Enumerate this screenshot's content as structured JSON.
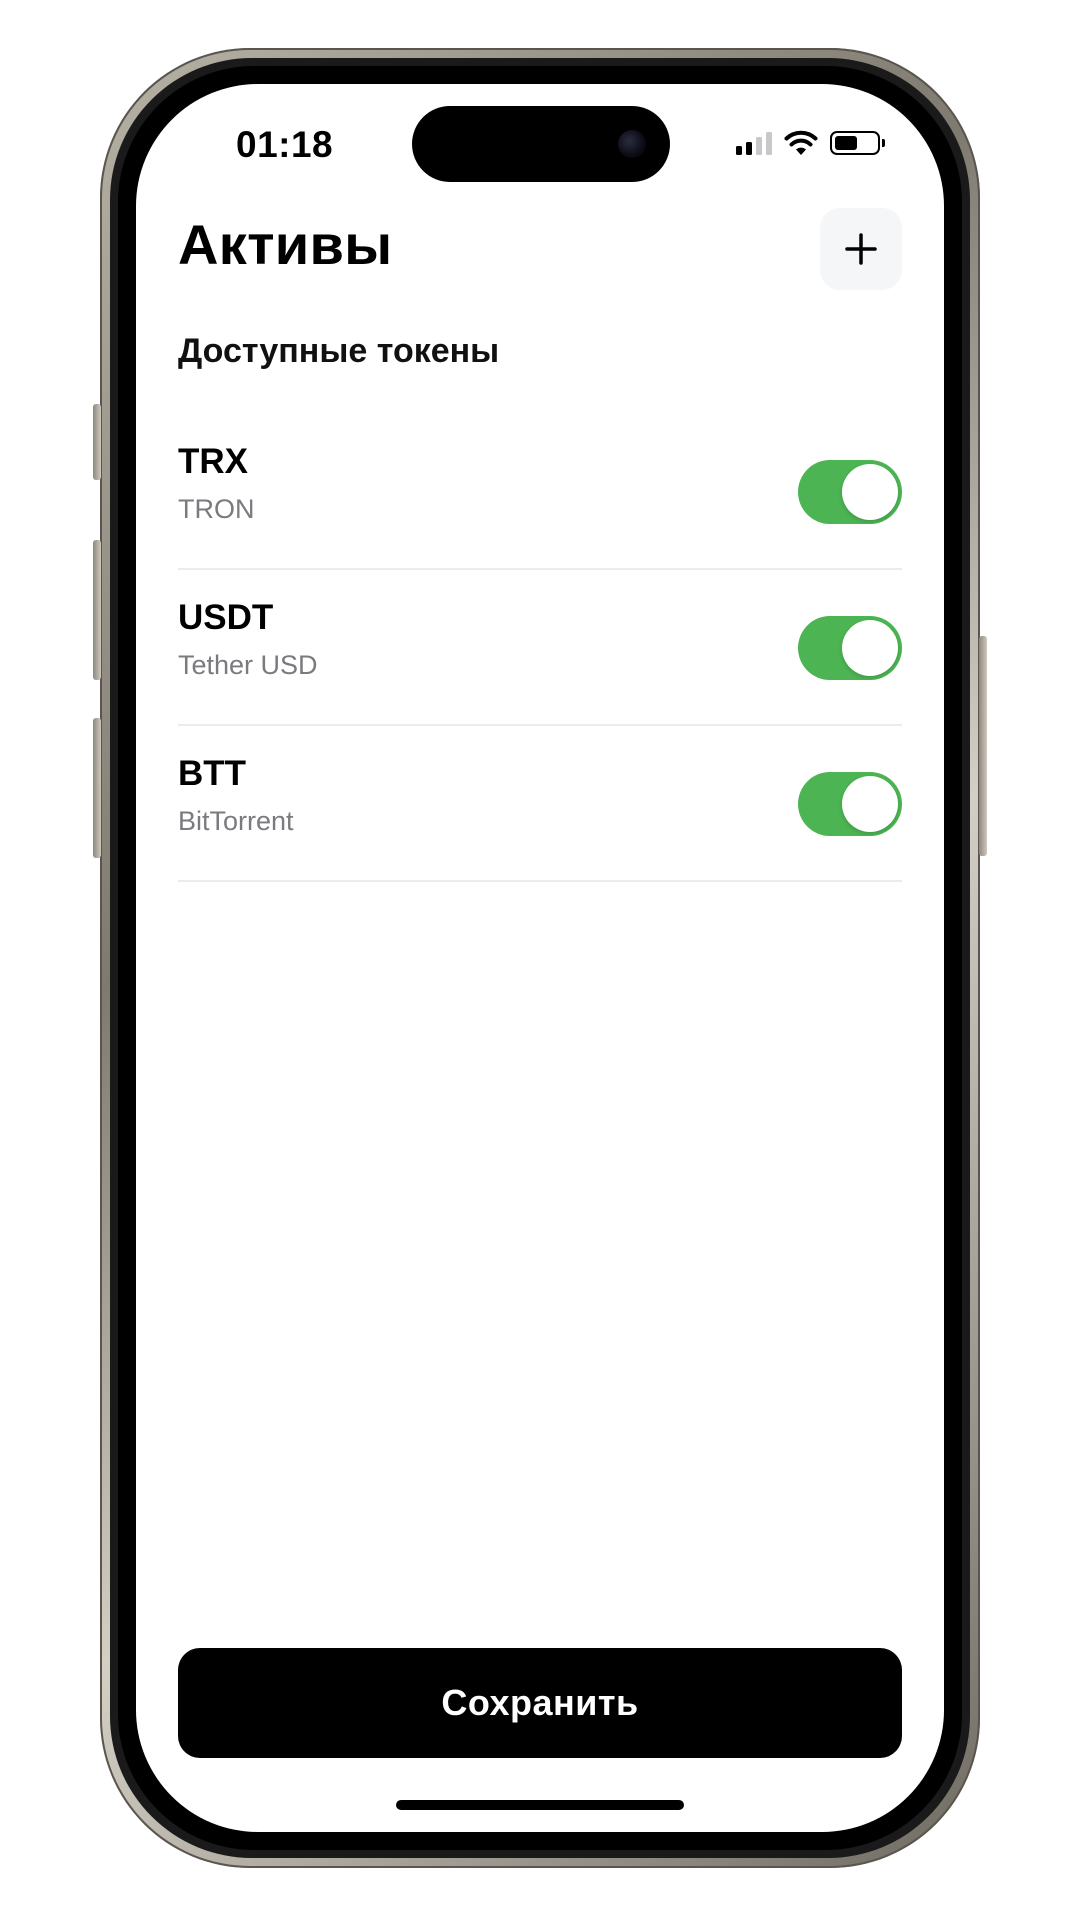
{
  "status_bar": {
    "time": "01:18",
    "icons": [
      "cellular-signal-icon",
      "wifi-icon",
      "battery-icon"
    ]
  },
  "header": {
    "title": "Активы",
    "add_button_icon": "plus-icon"
  },
  "section": {
    "title": "Доступные токены"
  },
  "tokens": [
    {
      "symbol": "TRX",
      "name": "TRON",
      "enabled": true
    },
    {
      "symbol": "USDT",
      "name": "Tether USD",
      "enabled": true
    },
    {
      "symbol": "BTT",
      "name": "BitTorrent",
      "enabled": true
    }
  ],
  "footer": {
    "save_label": "Сохранить"
  },
  "colors": {
    "toggle_on": "#4cb453",
    "primary_button": "#000000",
    "add_button_bg": "#f5f6f8",
    "secondary_text": "#7a7a7f"
  }
}
